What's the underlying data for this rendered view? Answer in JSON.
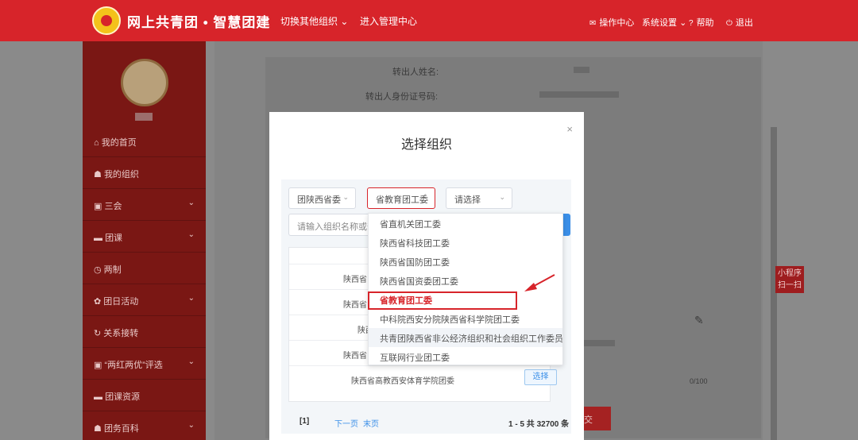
{
  "header": {
    "brand": "网上共青团 • 智慧团建",
    "nav": [
      "切换其他组织",
      "进入管理中心"
    ],
    "right": [
      "操作中心",
      "系统设置",
      "帮助",
      "退出"
    ]
  },
  "sidebar": {
    "items": [
      {
        "label": "我的首页",
        "icon": "home-icon"
      },
      {
        "label": "我的组织",
        "icon": "group-icon"
      },
      {
        "label": "三会",
        "icon": "square-icon",
        "chev": "⌄"
      },
      {
        "label": "团课",
        "icon": "folder-icon",
        "chev": "⌄"
      },
      {
        "label": "两制",
        "icon": "clock-icon"
      },
      {
        "label": "团日活动",
        "icon": "gear-icon",
        "chev": "⌄"
      },
      {
        "label": "关系接转",
        "icon": "refresh-icon"
      },
      {
        "label": "“两红两优”评选",
        "icon": "square-icon",
        "chev": "⌄"
      },
      {
        "label": "团课资源",
        "icon": "folder-icon"
      },
      {
        "label": "团务百科",
        "icon": "group-icon",
        "chev": "⌄"
      }
    ]
  },
  "form": {
    "name_label": "转出人姓名:",
    "id_label": "转出人身份证号码:",
    "counter": "0/100",
    "qr_tag": "小程序 扫一扫"
  },
  "modal": {
    "title": "选择组织",
    "close": "×",
    "filters": {
      "province": "团陕西省委",
      "system": "省教育团工委",
      "third": "请选择"
    },
    "search_placeholder": "请输入组织名称或部",
    "rows": [
      "陕西省",
      "陕西省",
      "陕西",
      "陕西省",
      "陕西省高教西安体育学院团委"
    ],
    "select_label": "选择",
    "pager": {
      "page": "[1]",
      "next": "下一页",
      "last": "末页",
      "summary": "1 - 5 共 32700 条"
    }
  },
  "dropdown": {
    "items": [
      "省直机关团工委",
      "陕西省科技团工委",
      "陕西省国防团工委",
      "陕西省国资委团工委",
      "省教育团工委",
      "中科院西安分院陕西省科学院团工委",
      "共青团陕西省非公经济组织和社会组织工作委员会",
      "互联网行业团工委"
    ],
    "selected_index": 4,
    "hover_index": 6
  },
  "colors": {
    "brand_red": "#d7242a",
    "link_blue": "#3b8fe8"
  }
}
